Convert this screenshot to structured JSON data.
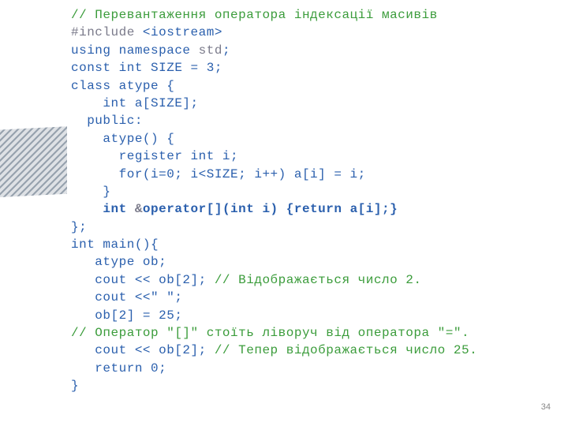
{
  "code": {
    "l1": "// Перевантаження оператора індексації масивів",
    "l2a": "#include ",
    "l2b": "<iostream>",
    "l3a": "using namespace ",
    "l3b": "std",
    "l3c": ";",
    "l4": "const int SIZE = 3;",
    "l5": "class atype {",
    "l6": "    int a[SIZE];",
    "l7": "  public:",
    "l8": "    atype() {",
    "l9": "      register int i;",
    "l10": "      for(i=0; i<SIZE; i++) a[i] = i;",
    "l11": "    }",
    "l12a": "    int ",
    "l12b": "&",
    "l12c": "operator[](int i) {return a[i];}",
    "l13": "};",
    "l14": "int main(){",
    "l15": "   atype ob;",
    "l16a": "   cout << ob[2]; ",
    "l16b": "// Відображається число 2.",
    "l17": "   cout <<\" \";",
    "l18": "   ob[2] = 25;",
    "l19": "// Оператор \"[]\" стоїть ліворуч від оператора \"=\".",
    "l20a": "   cout << ob[2]; ",
    "l20b": "// Тепер відображається число 25.",
    "l21": "   return 0;",
    "l22": "}"
  },
  "pageNumber": "34"
}
